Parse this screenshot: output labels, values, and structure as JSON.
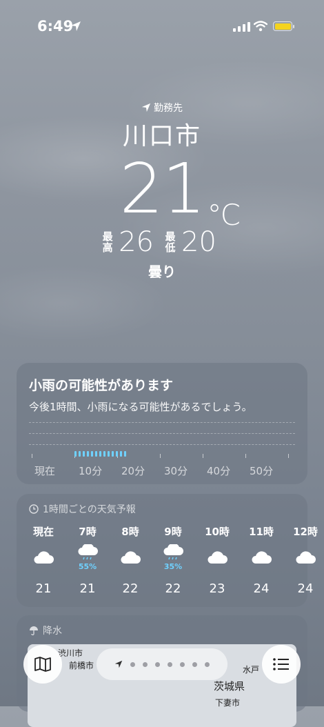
{
  "status_bar": {
    "time": "6:49"
  },
  "location": {
    "label": "勤務先",
    "city": "川口市",
    "temperature": "21",
    "unit": "°C",
    "high_label": "最高",
    "high": "26",
    "low_label": "最低",
    "low": "20",
    "condition": "曇り"
  },
  "precip_card": {
    "title": "小雨の可能性があります",
    "subtitle": "今後1時間、小雨になる可能性があるでしょう。",
    "x_labels": [
      "現在",
      "10分",
      "20分",
      "30分",
      "40分",
      "50分"
    ]
  },
  "hourly_card": {
    "header": "1時間ごとの天気予報",
    "hours": [
      {
        "label": "現在",
        "icon": "cloud-icon",
        "pop": "",
        "temp": "21"
      },
      {
        "label": "7時",
        "icon": "cloud-rain-icon",
        "pop": "55%",
        "temp": "21"
      },
      {
        "label": "8時",
        "icon": "cloud-icon",
        "pop": "",
        "temp": "22"
      },
      {
        "label": "9時",
        "icon": "cloud-rain-icon",
        "pop": "35%",
        "temp": "22"
      },
      {
        "label": "10時",
        "icon": "cloud-icon",
        "pop": "",
        "temp": "23"
      },
      {
        "label": "11時",
        "icon": "cloud-icon",
        "pop": "",
        "temp": "24"
      },
      {
        "label": "12時",
        "icon": "cloud-icon",
        "pop": "",
        "temp": "24"
      }
    ]
  },
  "precip_map_card": {
    "header": "降水",
    "places": [
      "渋川市",
      "前橋市",
      "水戸",
      "茨城県",
      "下妻市"
    ]
  },
  "colors": {
    "rain": "#6fd1ff",
    "battery": "#f4d31f"
  }
}
